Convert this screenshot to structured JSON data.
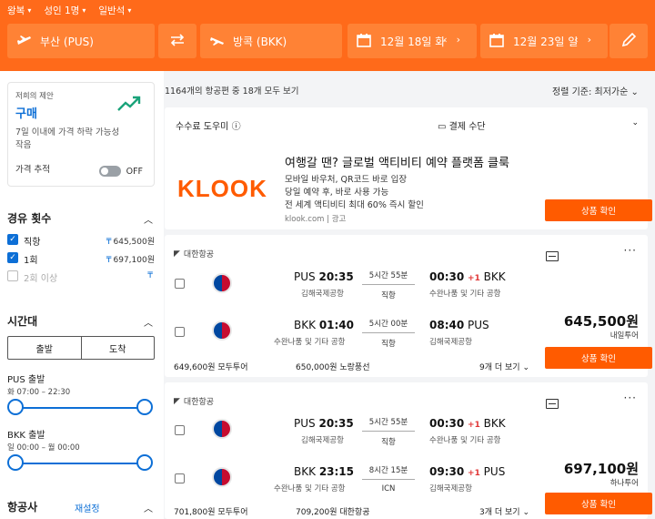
{
  "topnav": {
    "trip_type": "왕복",
    "passengers": "성인 1명",
    "cabin": "일반석"
  },
  "search": {
    "origin": "부산 (PUS)",
    "destination": "방콕 (BKK)",
    "depart_date": "12월 18일 화",
    "return_date": "12월 23일 일"
  },
  "advice": {
    "small": "저희의 제안",
    "action": "구매",
    "desc": "7일 이내에 가격 하락 가능성 작음",
    "tracker_label": "가격 추적",
    "tracker_state": "OFF"
  },
  "filters": {
    "stops_title": "경유 횟수",
    "stops": [
      {
        "label": "직항",
        "price": "645,500원",
        "checked": true
      },
      {
        "label": "1회",
        "price": "697,100원",
        "checked": true
      },
      {
        "label": "2회 이상",
        "price": "",
        "checked": false
      }
    ],
    "time_title": "시간대",
    "time_tabs": [
      "출발",
      "도착"
    ],
    "pus_depart_label": "PUS 출발",
    "pus_depart_range": "화 07:00 – 22:30",
    "bkk_depart_label": "BKK 출발",
    "bkk_depart_range": "일 00:00 – 월 00:00",
    "airline_title": "항공사",
    "airline_reset": "재설정"
  },
  "results": {
    "count_text": "1164개의 항공편 중 18개 모두 보기",
    "sort_text": "정렬 기준: 최저가순"
  },
  "ad": {
    "fee_helper": "수수료 도우미",
    "payment": "결제 수단",
    "logo": "KLOOK",
    "title": "여행갈 땐? 글로벌 액티비티 예약 플랫폼 클룩",
    "lines": [
      "모바일 바우처, QR코드 바로 입장",
      "당일 예약 후, 바로 사용 가능",
      "전 세계 액티비티 최대 60% 즉시 할인"
    ],
    "url": "klook.com | 광고",
    "cta": "상품 확인"
  },
  "flights": [
    {
      "airline": "대한항공",
      "out": {
        "from": "PUS",
        "dep": "20:35",
        "from_airport": "김해국제공항",
        "duration": "5시간 55분",
        "stops": "직항",
        "arr": "00:30",
        "plus": "+1",
        "to": "BKK",
        "to_airport": "수완나품 및 기타 공항"
      },
      "ret": {
        "from": "BKK",
        "dep": "01:40",
        "from_airport": "수완나품 및 기타 공항",
        "duration": "5시간 00분",
        "stops": "직항",
        "arr": "08:40",
        "plus": "",
        "to": "PUS",
        "to_airport": "김해국제공항"
      },
      "price": "645,500원",
      "agency": "내일투어",
      "alt1": "649,600원  모두투어",
      "alt2": "650,000원  노랑풍선",
      "more": "9개 더 보기",
      "cta": "상품 확인"
    },
    {
      "airline": "대한항공",
      "out": {
        "from": "PUS",
        "dep": "20:35",
        "from_airport": "김해국제공항",
        "duration": "5시간 55분",
        "stops": "직항",
        "arr": "00:30",
        "plus": "+1",
        "to": "BKK",
        "to_airport": "수완나품 및 기타 공항"
      },
      "ret": {
        "from": "BKK",
        "dep": "23:15",
        "from_airport": "수완나품 및 기타 공항",
        "duration": "8시간 15분",
        "stops": "ICN",
        "arr": "09:30",
        "plus": "+1",
        "to": "PUS",
        "to_airport": "김해국제공항"
      },
      "price": "697,100원",
      "agency": "하나투어",
      "alt1": "701,800원  모두투어",
      "alt2": "709,200원  대한항공",
      "more": "3개 더 보기",
      "cta": "상품 확인"
    }
  ],
  "colors": {
    "brand_orange": "#ff6a1a",
    "field_orange": "#ff8235",
    "cta_orange": "#ff5b00",
    "link_blue": "#0d6fd6"
  }
}
